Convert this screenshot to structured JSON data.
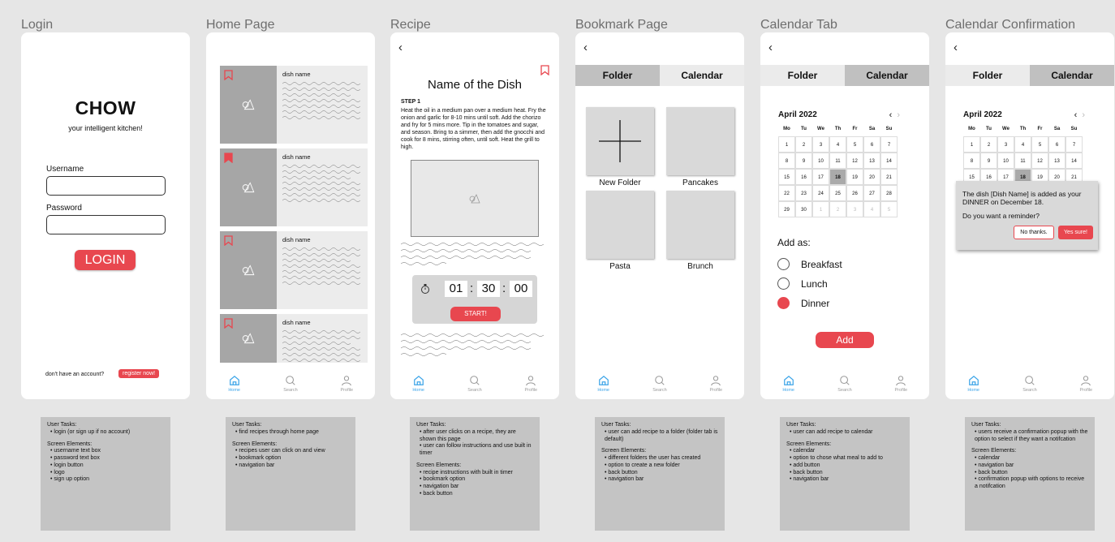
{
  "screens": {
    "login": {
      "title": "Login",
      "logo": "CHOW",
      "tagline": "your intelligent kitchen!",
      "username_label": "Username",
      "password_label": "Password",
      "login_button": "LOGIN",
      "no_account": "don't have an account?",
      "register_button": "register now!"
    },
    "home": {
      "title": "Home Page",
      "card_title": "dish name",
      "nav": {
        "home": "Home",
        "search": "Search",
        "profile": "Profile"
      }
    },
    "recipe": {
      "title": "Recipe",
      "dish": "Name of the Dish",
      "step": "STEP 1",
      "instructions": "Heat the oil in a medium pan over a medium heat. Fry the onion and garlic for 8-10 mins until soft. Add the chorizo and fry for 5 mins more. Tip in the tomatoes and sugar, and season. Bring to a simmer, then add the gnocchi and cook for 8 mins, stirring often, until soft. Heat the grill to high.",
      "timer": {
        "h": "01",
        "m": "30",
        "s": "00"
      },
      "start_button": "START!"
    },
    "bookmark": {
      "title": "Bookmark Page",
      "tab_folder": "Folder",
      "tab_calendar": "Calendar",
      "folders": [
        "New Folder",
        "Pancakes",
        "Pasta",
        "Brunch"
      ]
    },
    "calendar": {
      "title": "Calendar Tab",
      "month": "April 2022",
      "weekdays": [
        "Mo",
        "Tu",
        "We",
        "Th",
        "Fr",
        "Sa",
        "Su"
      ],
      "days": [
        "1",
        "2",
        "3",
        "4",
        "5",
        "6",
        "7",
        "8",
        "9",
        "10",
        "11",
        "12",
        "13",
        "14",
        "15",
        "16",
        "17",
        "18",
        "19",
        "20",
        "21",
        "22",
        "23",
        "24",
        "25",
        "26",
        "27",
        "28",
        "29",
        "30",
        "1",
        "2",
        "3",
        "4",
        "5"
      ],
      "selected_day": "18",
      "add_as": "Add as:",
      "meals": [
        "Breakfast",
        "Lunch",
        "Dinner"
      ],
      "selected_meal": "Dinner",
      "add_button": "Add"
    },
    "confirm": {
      "title": "Calendar Confirmation",
      "message": "The dish [Dish Name] is added as your DINNER on December 18.",
      "question": "Do you want a reminder?",
      "no_button": "No thanks.",
      "yes_button": "Yes sure!"
    }
  },
  "notes": {
    "login": {
      "tasks": [
        "login (or sign up if no account)"
      ],
      "elements": [
        "username text box",
        "password text box",
        "login button",
        "logo",
        "sign up option"
      ]
    },
    "home": {
      "tasks": [
        "find recipes through home page"
      ],
      "elements": [
        "recipes user can click on and view",
        "bookmark option",
        "navigation bar"
      ]
    },
    "recipe": {
      "tasks": [
        "after user clicks on a recipe, they are shown this page",
        "user can follow instructions and use built in timer"
      ],
      "elements": [
        "recipe instructions with built in timer",
        "bookmark option",
        "navigation bar",
        "back button"
      ]
    },
    "bookmark": {
      "tasks": [
        "user can add recipe to a folder (folder tab is default)"
      ],
      "elements": [
        "different folders the user has created",
        "option to create a new folder",
        "back button",
        "navigation bar"
      ]
    },
    "calendar": {
      "tasks": [
        "user can add recipe to calendar"
      ],
      "elements": [
        "calendar",
        "option to chose what meal to add to",
        "add button",
        "back button",
        "navigation bar"
      ]
    },
    "confirm": {
      "tasks": [
        "users receive a confirmation popup with the option to select if they want a notifcation"
      ],
      "elements": [
        "calendar",
        "navigation bar",
        "back button",
        "confirmation popup with options to receive a notifcation"
      ]
    },
    "labels": {
      "tasks": "User Tasks:",
      "elements": "Screen Elements:"
    }
  },
  "colors": {
    "accent": "#e8474f",
    "bookmark": "#e8474f",
    "nav_active": "#3ba4e8",
    "placeholder": "#a6a6a6"
  },
  "icons": {
    "bookmark": "bookmark-icon",
    "image": "image-placeholder-icon",
    "timer": "stopwatch-icon",
    "back": "chevron-left-icon",
    "home": "home-icon",
    "search": "search-icon",
    "profile": "profile-icon"
  }
}
